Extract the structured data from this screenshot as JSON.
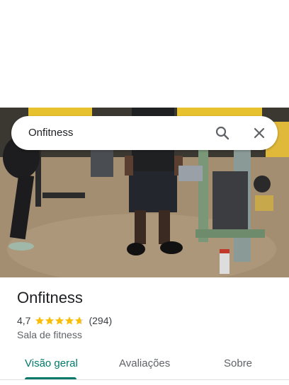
{
  "search": {
    "query": "Onfitness"
  },
  "icons": {
    "search": "search-icon",
    "close": "close-icon",
    "star": "star-icon"
  },
  "place": {
    "name": "Onfitness",
    "rating": "4,7",
    "rating_value": 4.7,
    "review_count": "(294)",
    "category": "Sala de fitness"
  },
  "tabs": [
    {
      "label": "Visão geral",
      "active": true
    },
    {
      "label": "Avaliações",
      "active": false
    },
    {
      "label": "Sobre",
      "active": false
    }
  ],
  "colors": {
    "accent": "#00796b",
    "star": "#fbbc04",
    "text_primary": "#202124",
    "text_secondary": "#5f6368",
    "gym_wall_yellow": "#e8c22e"
  }
}
